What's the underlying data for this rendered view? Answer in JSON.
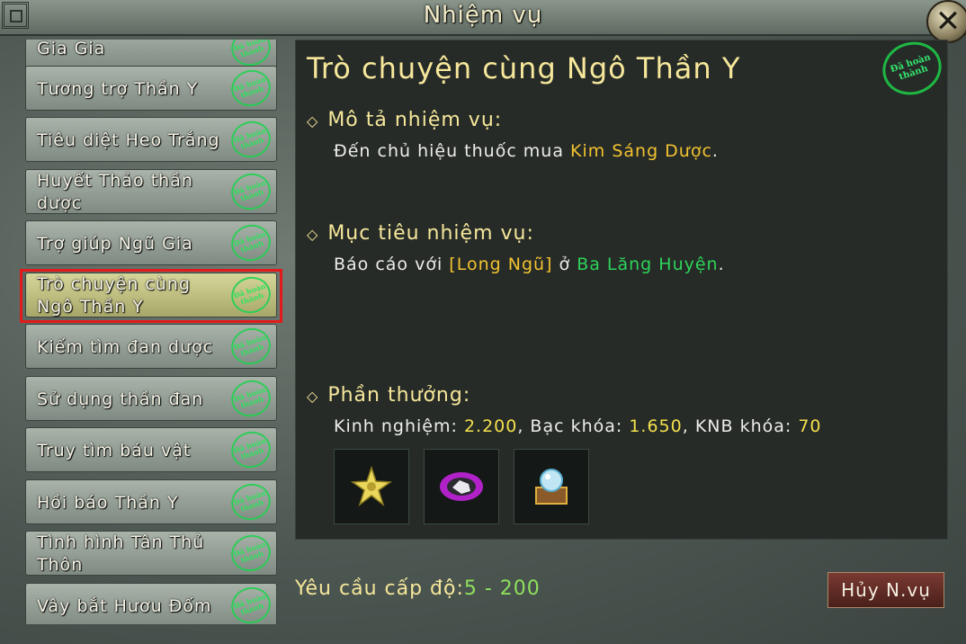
{
  "window": {
    "title": "Nhiệm vụ"
  },
  "stamp_text": "Đã hoàn thành",
  "quests": [
    {
      "label": "Gia Gia"
    },
    {
      "label": "Tương trợ Thần Y"
    },
    {
      "label": "Tiêu diệt Heo Trắng"
    },
    {
      "label": "Huyết Thảo thần dược"
    },
    {
      "label": "Trợ giúp Ngũ Gia"
    },
    {
      "label": "Trò chuyện cùng Ngô Thần Y",
      "selected": true
    },
    {
      "label": "Kiếm tìm đan dược"
    },
    {
      "label": "Sử dụng thần đan"
    },
    {
      "label": "Truy tìm báu vật"
    },
    {
      "label": "Hồi báo Thần Y"
    },
    {
      "label": "Tình hình Tân Thủ Thôn"
    },
    {
      "label": "Vây bắt Hươu Đốm"
    }
  ],
  "detail": {
    "title": "Trò chuyện cùng Ngô Thần Y",
    "desc_heading": "Mô tả nhiệm vụ:",
    "desc_prefix": "Đến chủ hiệu thuốc mua ",
    "desc_item": "Kim Sáng Dược",
    "desc_suffix": ".",
    "goal_heading": "Mục tiêu nhiệm vụ:",
    "goal_prefix": "Báo cáo với ",
    "goal_npc": "[Long Ngũ]",
    "goal_mid": " ở ",
    "goal_place": "Ba Lăng Huyện",
    "goal_suffix": ".",
    "reward_heading": "Phần thưởng:",
    "reward_exp_label": "Kinh nghiệm: ",
    "reward_exp": "2.200",
    "reward_silver_label": ", Bạc khóa: ",
    "reward_silver": "1.650",
    "reward_knb_label": ", KNB khóa: ",
    "reward_knb": "70",
    "reward_items": [
      "star-flower-icon",
      "purple-ore-icon",
      "crystal-chest-icon"
    ]
  },
  "footer": {
    "level_label": "Yêu cầu cấp độ:",
    "level_value": "5 - 200"
  },
  "cancel_label": "Hủy N.vụ",
  "colors": {
    "accent_yellow": "#f6e79a",
    "highlight_orange": "#f2c230",
    "place_green": "#2ed35a",
    "selection_red": "#e31a1a"
  }
}
